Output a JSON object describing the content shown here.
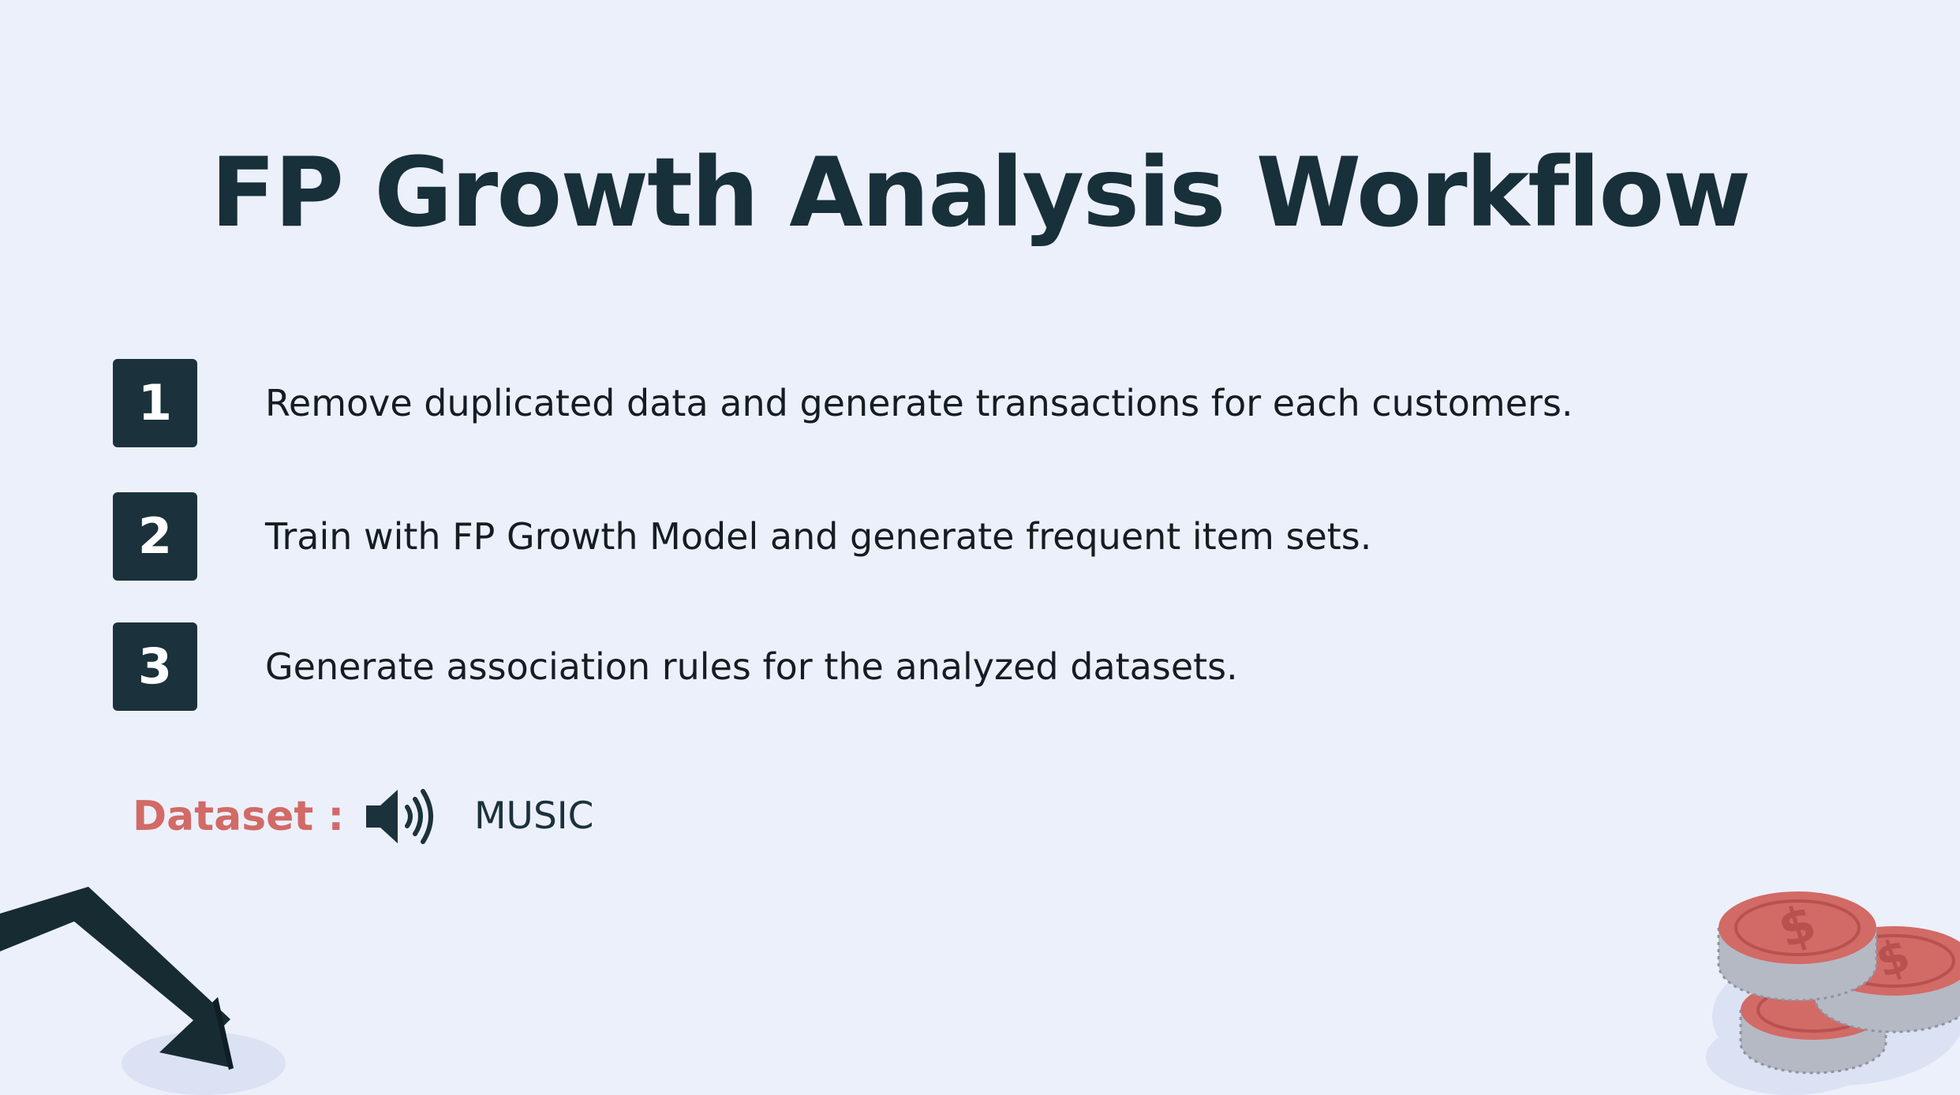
{
  "slide": {
    "title": "FP Growth Analysis Workflow",
    "steps": [
      {
        "number": "1",
        "text": "Remove duplicated data and generate transactions for each customers."
      },
      {
        "number": "2",
        "text": "Train with FP Growth Model and generate frequent item sets."
      },
      {
        "number": "3",
        "text": "Generate association rules for the analyzed datasets."
      }
    ],
    "dataset": {
      "label": "Dataset :",
      "icon": "speaker-icon",
      "value": "MUSIC"
    }
  },
  "colors": {
    "background": "#ecf0fb",
    "title": "#18303a",
    "badge": "#1b323c",
    "accent": "#d26a66",
    "coin": "#d26a66"
  }
}
